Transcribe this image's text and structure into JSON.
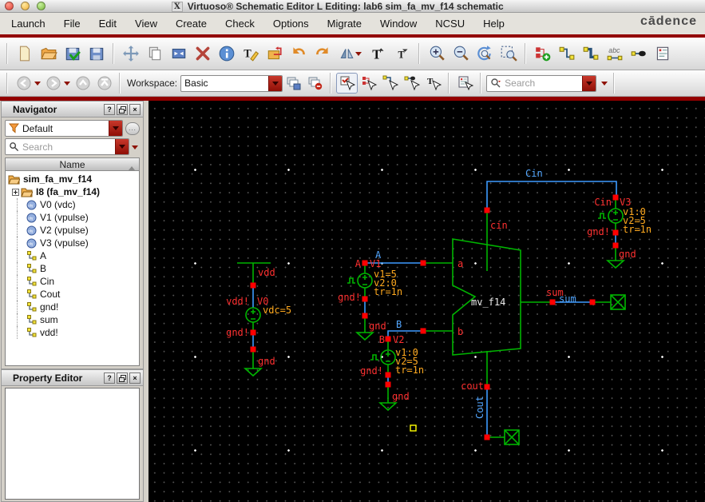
{
  "window": {
    "title": "Virtuoso® Schematic Editor L Editing: lab6 sim_fa_mv_f14 schematic",
    "logo": "cādence"
  },
  "menu": {
    "items": [
      "Launch",
      "File",
      "Edit",
      "View",
      "Create",
      "Check",
      "Options",
      "Migrate",
      "Window",
      "NCSU",
      "Help"
    ]
  },
  "toolbar": {
    "row1_icons": [
      "new-file",
      "open",
      "check-and-save",
      "save",
      "move",
      "copy",
      "stretch",
      "delete",
      "object-properties",
      "label-edit",
      "descend",
      "undo",
      "redo",
      "rotate",
      "font-enlarge",
      "font-shrink",
      "zoom-in",
      "zoom-out",
      "zoom-fit",
      "zoom-area",
      "create-instance",
      "create-wire",
      "create-bus",
      "create-wire-name",
      "create-pin",
      "property-form"
    ],
    "row2_icons": [
      "back",
      "forward",
      "up",
      "top",
      "workspace-save",
      "workspace-revert",
      "select-mode",
      "select-instance",
      "select-wire",
      "select-pin",
      "select-label",
      "query-properties",
      "search"
    ],
    "workspace_label": "Workspace:",
    "workspace_value": "Basic",
    "search_placeholder": "Search"
  },
  "navigator": {
    "title": "Navigator",
    "filter_value": "Default",
    "more_button": "...",
    "search_placeholder": "Search",
    "column_header": "Name",
    "tree": [
      {
        "icon": "folder",
        "label": "sim_fa_mv_f14"
      },
      {
        "icon": "folder",
        "label": "I8 (fa_mv_f14)"
      },
      {
        "icon": "object",
        "label": "V0 (vdc)"
      },
      {
        "icon": "object",
        "label": "V1 (vpulse)"
      },
      {
        "icon": "object",
        "label": "V2 (vpulse)"
      },
      {
        "icon": "object",
        "label": "V3 (vpulse)"
      },
      {
        "icon": "net",
        "label": "A"
      },
      {
        "icon": "net",
        "label": "B"
      },
      {
        "icon": "net",
        "label": "Cin"
      },
      {
        "icon": "net",
        "label": "Cout"
      },
      {
        "icon": "net",
        "label": "gnd!"
      },
      {
        "icon": "net",
        "label": "sum"
      },
      {
        "icon": "net",
        "label": "vdd!"
      }
    ]
  },
  "property_editor": {
    "title": "Property Editor"
  },
  "schematic": {
    "instance": {
      "name": "mv_f14",
      "pins": {
        "a": "a",
        "b": "b",
        "cin": "cin",
        "cout": "cout",
        "sum": "sum"
      }
    },
    "nets": {
      "cin": "Cin",
      "a": "A",
      "b": "B",
      "sum": "sum",
      "cout": "Cout"
    },
    "rail": {
      "vdd": "vdd"
    },
    "sources": {
      "v0": {
        "name": "V0",
        "net": "vdd!",
        "props": [
          "vdc=5"
        ],
        "gnd_net": "gnd!",
        "gnd": "gnd"
      },
      "v1": {
        "name": "V1",
        "net": "A",
        "props": [
          "v1=5",
          "v2:0",
          "tr=1n"
        ],
        "gnd_net": "gnd!",
        "gnd": "gnd"
      },
      "v2": {
        "name": "V2",
        "net": "B",
        "props": [
          "v1:0",
          "v2=5",
          "tr=1n"
        ],
        "gnd_net": "gnd!",
        "gnd": "gnd"
      },
      "v3": {
        "name": "V3",
        "net": "Cin",
        "props": [
          "v1:0",
          "v2=5",
          "tr=1n"
        ],
        "gnd_net": "gnd!",
        "gnd": "gnd"
      }
    },
    "colors": {
      "wire_green": "#00b400",
      "wire_blue": "#3d9bff",
      "pin_red": "#ff3030",
      "prop_orange": "#ffa91e",
      "select_yellow": "#ffff00"
    }
  }
}
